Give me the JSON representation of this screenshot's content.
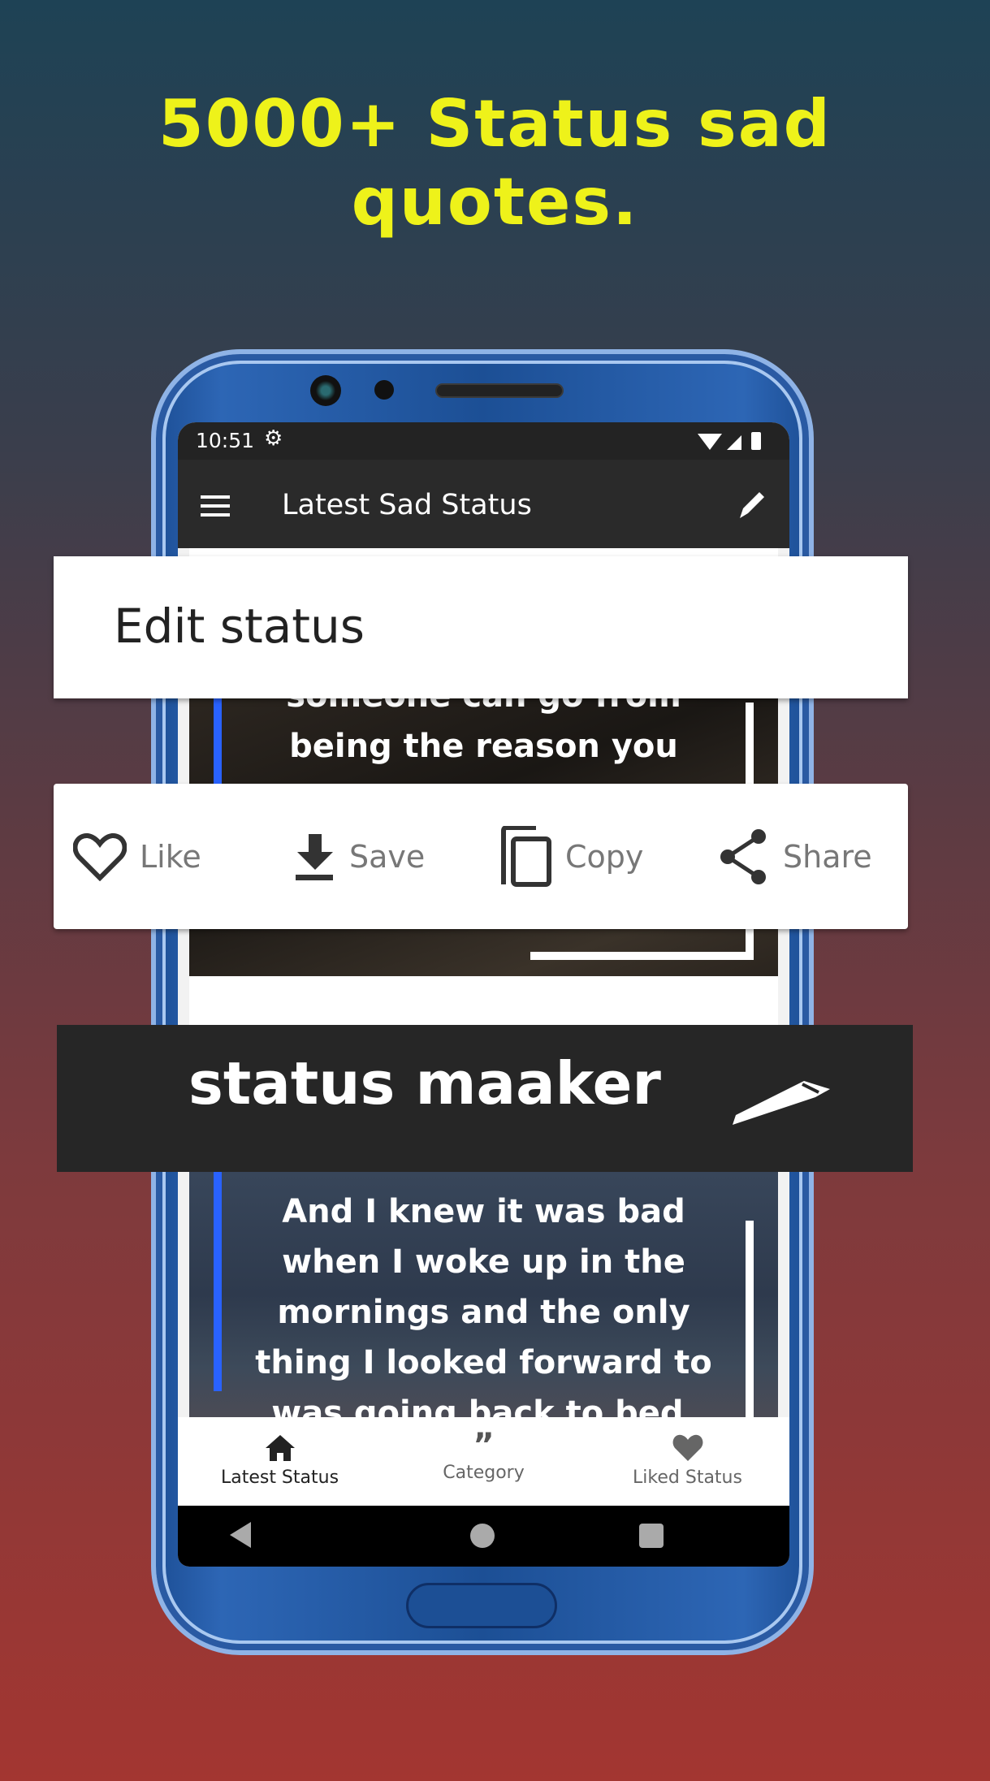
{
  "headline": {
    "line1": "5000+ Status sad",
    "line2": "quotes."
  },
  "status_bar": {
    "time": "10:51"
  },
  "app_bar": {
    "title": "Latest Sad Status"
  },
  "edit_banner": {
    "label": "Edit status"
  },
  "card1": {
    "lines": [
      "someone can go from",
      "being the reason you"
    ]
  },
  "actions": {
    "like": "Like",
    "save": "Save",
    "copy": "Copy",
    "share": "Share"
  },
  "maker_banner": {
    "label": "status maaker"
  },
  "card2": {
    "lines": [
      "And I knew it was bad",
      "when I woke up in the",
      "mornings and the only",
      "thing I looked forward to",
      "was going back to bed."
    ]
  },
  "bottom_nav": {
    "items": [
      {
        "label": "Latest Status",
        "icon": "home-icon",
        "active": true
      },
      {
        "label": "Category",
        "icon": "quote-icon"
      },
      {
        "label": "Liked Status",
        "icon": "heart-icon"
      }
    ]
  },
  "colors": {
    "headline": "#eef21a",
    "accent_bar": "#2962ff",
    "appbar": "#2a2a2a"
  }
}
